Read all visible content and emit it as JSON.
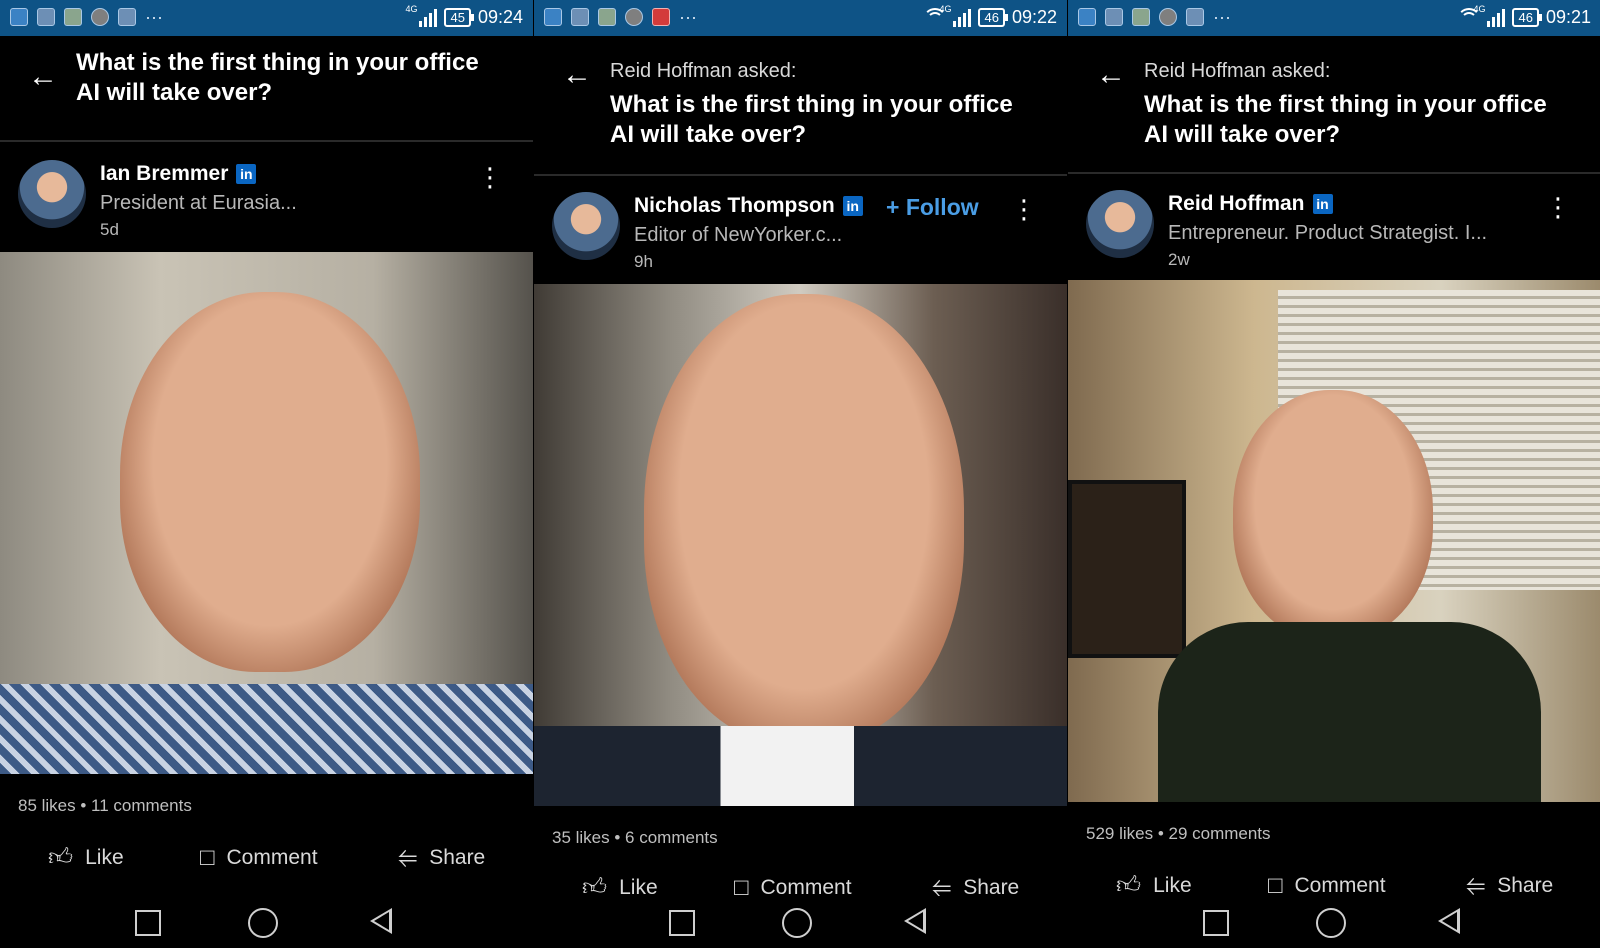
{
  "panels": [
    {
      "status": {
        "time": "09:24",
        "battery": "45",
        "network": "4G"
      },
      "header": {
        "asked": "",
        "question": "What is the first thing in your office AI will take over?"
      },
      "author": {
        "name": "Ian Bremmer",
        "headline": "President at Eurasia...",
        "time": "5d",
        "follow": ""
      },
      "stats": "85 likes • 11 comments",
      "actions": {
        "like": "Like",
        "comment": "Comment",
        "share": "Share"
      }
    },
    {
      "status": {
        "time": "09:22",
        "battery": "46",
        "network": "4G"
      },
      "header": {
        "asked": "Reid Hoffman asked:",
        "question": "What is the first thing in your office AI will take over?"
      },
      "author": {
        "name": "Nicholas Thompson",
        "headline": "Editor of NewYorker.c...",
        "time": "9h",
        "follow": "+ Follow"
      },
      "stats": "35 likes • 6 comments",
      "actions": {
        "like": "Like",
        "comment": "Comment",
        "share": "Share"
      }
    },
    {
      "status": {
        "time": "09:21",
        "battery": "46",
        "network": "4G"
      },
      "header": {
        "asked": "Reid Hoffman asked:",
        "question": "What is the first thing in your office AI will take over?"
      },
      "author": {
        "name": "Reid Hoffman",
        "headline": "Entrepreneur.  Product Strategist.  I...",
        "time": "2w",
        "follow": ""
      },
      "stats": "529 likes • 29 comments",
      "actions": {
        "like": "Like",
        "comment": "Comment",
        "share": "Share"
      }
    }
  ],
  "badges": {
    "linkedin": "in"
  },
  "colors": {
    "statusbar": "#0e5386",
    "follow": "#4a9de5",
    "linkedin": "#0a66c2"
  }
}
